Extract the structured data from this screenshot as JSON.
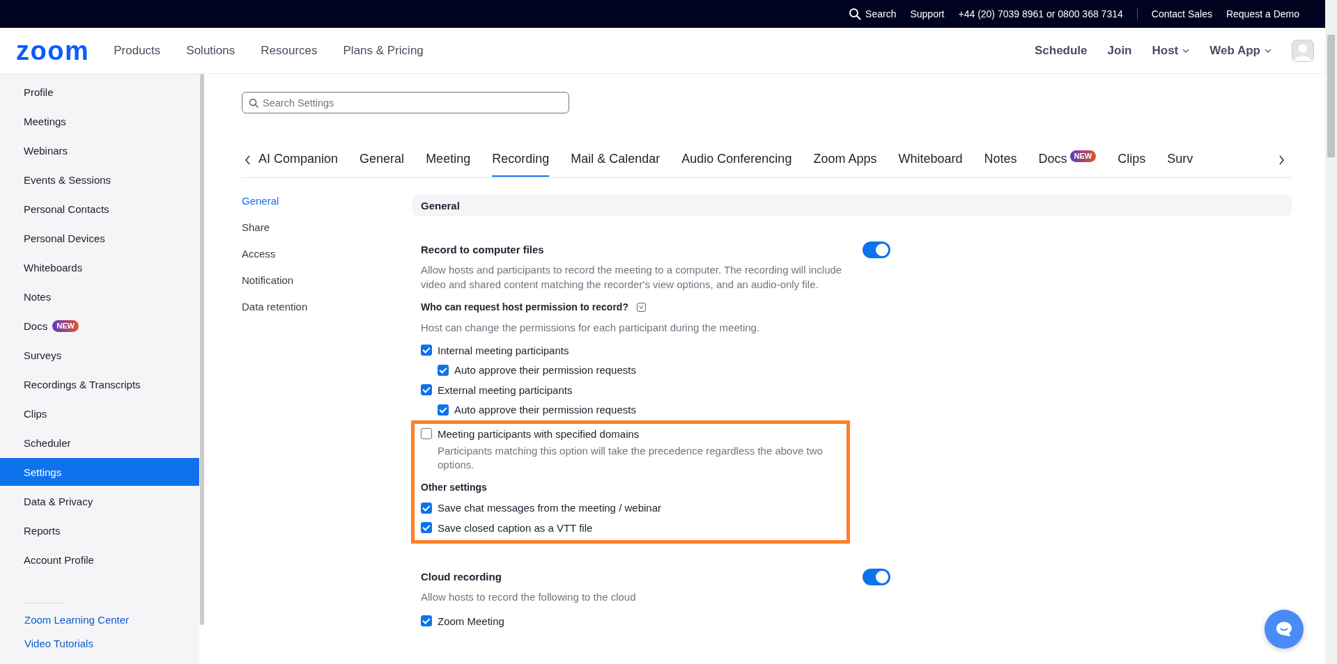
{
  "top_bar": {
    "links": [
      {
        "kind": "search",
        "label": "Search"
      },
      {
        "kind": "link",
        "label": "Support"
      },
      {
        "kind": "link",
        "label": "+44 (20) 7039 8961 or 0800 368 7314"
      },
      {
        "kind": "divider"
      },
      {
        "kind": "link",
        "label": "Contact Sales"
      },
      {
        "kind": "link",
        "label": "Request a Demo"
      }
    ]
  },
  "header": {
    "logo": "zoom",
    "nav": [
      "Products",
      "Solutions",
      "Resources",
      "Plans & Pricing"
    ],
    "actions": [
      {
        "label": "Schedule",
        "dropdown": false
      },
      {
        "label": "Join",
        "dropdown": false
      },
      {
        "label": "Host",
        "dropdown": true
      },
      {
        "label": "Web App",
        "dropdown": true
      }
    ]
  },
  "sidebar": {
    "items": [
      {
        "label": "Profile",
        "selected": false
      },
      {
        "label": "Meetings",
        "selected": false
      },
      {
        "label": "Webinars",
        "selected": false
      },
      {
        "label": "Events & Sessions",
        "selected": false
      },
      {
        "label": "Personal Contacts",
        "selected": false
      },
      {
        "label": "Personal Devices",
        "selected": false
      },
      {
        "label": "Whiteboards",
        "selected": false
      },
      {
        "label": "Notes",
        "selected": false
      },
      {
        "label": "Docs",
        "selected": false,
        "badge": "NEW"
      },
      {
        "label": "Surveys",
        "selected": false
      },
      {
        "label": "Recordings & Transcripts",
        "selected": false
      },
      {
        "label": "Clips",
        "selected": false
      },
      {
        "label": "Scheduler",
        "selected": false
      },
      {
        "label": "Settings",
        "selected": true
      },
      {
        "label": "Data & Privacy",
        "selected": false
      },
      {
        "label": "Reports",
        "selected": false
      },
      {
        "label": "Account Profile",
        "selected": false
      }
    ],
    "footer_links": [
      "Zoom Learning Center",
      "Video Tutorials"
    ]
  },
  "search": {
    "placeholder": "Search Settings"
  },
  "tabs": [
    {
      "label": "AI Companion",
      "selected": false
    },
    {
      "label": "General",
      "selected": false
    },
    {
      "label": "Meeting",
      "selected": false
    },
    {
      "label": "Recording",
      "selected": true
    },
    {
      "label": "Mail & Calendar",
      "selected": false
    },
    {
      "label": "Audio Conferencing",
      "selected": false
    },
    {
      "label": "Zoom Apps",
      "selected": false
    },
    {
      "label": "Whiteboard",
      "selected": false
    },
    {
      "label": "Notes",
      "selected": false
    },
    {
      "label": "Docs",
      "selected": false,
      "badge": "NEW"
    },
    {
      "label": "Clips",
      "selected": false
    },
    {
      "label": "Surv",
      "selected": false
    }
  ],
  "subnav": [
    {
      "label": "General",
      "selected": true
    },
    {
      "label": "Share",
      "selected": false
    },
    {
      "label": "Access",
      "selected": false
    },
    {
      "label": "Notification",
      "selected": false
    },
    {
      "label": "Data retention",
      "selected": false
    }
  ],
  "section": {
    "title": "General",
    "blocks": [
      {
        "kind": "setting",
        "title": "Record to computer files",
        "on": true,
        "description": "Allow hosts and participants to record the meeting to a computer. The recording will include video and shared content matching the recorder's view options, and an audio-only file.",
        "highlighted": false
      },
      {
        "kind": "question",
        "title": "Who can request host permission to record?",
        "hint": "Host can change the permissions for each participant during the meeting.",
        "highlighted": false
      },
      {
        "kind": "checkbox",
        "label": "Internal meeting participants",
        "checked": true,
        "highlighted": false,
        "children": [
          {
            "label": "Auto approve their permission requests",
            "checked": true
          }
        ]
      },
      {
        "kind": "checkbox",
        "label": "External meeting participants",
        "checked": true,
        "highlighted": false,
        "children": [
          {
            "label": "Auto approve their permission requests",
            "checked": true
          }
        ]
      },
      {
        "kind": "checkbox",
        "label": "Meeting participants with specified domains",
        "checked": false,
        "note": "Participants matching this option will take the precedence regardless the above two options.",
        "highlighted": true
      },
      {
        "kind": "subheading",
        "title": "Other settings",
        "highlighted": true
      },
      {
        "kind": "checkbox",
        "label": "Save chat messages from the meeting / webinar",
        "checked": true,
        "highlighted": true
      },
      {
        "kind": "checkbox",
        "label": "Save closed caption as a VTT file",
        "checked": true,
        "highlighted": true
      },
      {
        "kind": "setting",
        "title": "Cloud recording",
        "on": true,
        "description": "Allow hosts to record the following to the cloud",
        "highlighted": false
      },
      {
        "kind": "checkbox",
        "label": "Zoom Meeting",
        "checked": true,
        "highlighted": false
      }
    ]
  }
}
